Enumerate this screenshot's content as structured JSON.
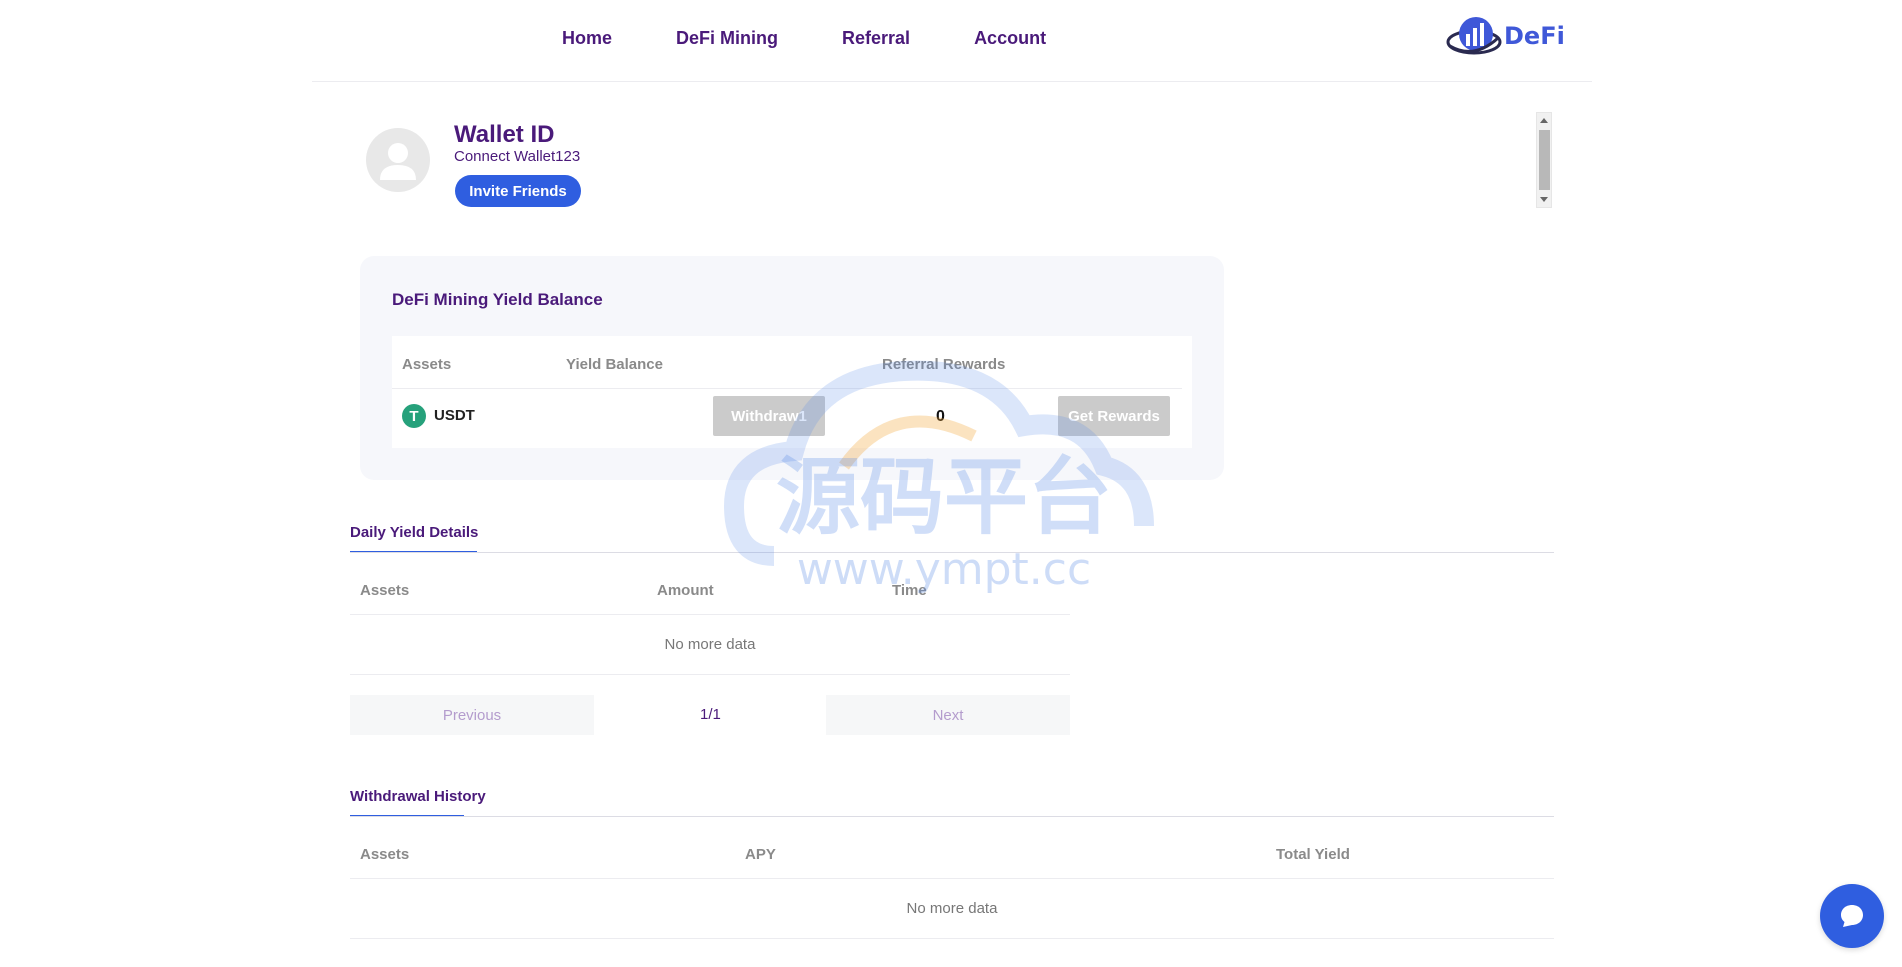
{
  "nav": {
    "items": [
      "Home",
      "DeFi Mining",
      "Referral",
      "Account"
    ],
    "logo_text": "DeFi"
  },
  "profile": {
    "title": "Wallet ID",
    "subtitle": "Connect Wallet123",
    "invite_label": "Invite Friends"
  },
  "yield_card": {
    "title": "DeFi Mining Yield Balance",
    "headers": [
      "Assets",
      "Yield Balance",
      "Referral Rewards"
    ],
    "row": {
      "asset_symbol": "T",
      "asset": "USDT",
      "withdraw_label": "Withdraw1",
      "referral_rewards": "0",
      "get_rewards_label": "Get Rewards"
    }
  },
  "daily_yield": {
    "tab_label": "Daily Yield Details",
    "headers": [
      "Assets",
      "Amount",
      "Time"
    ],
    "empty_text": "No more data",
    "pagination": {
      "previous_label": "Previous",
      "page": "1/1",
      "next_label": "Next"
    }
  },
  "withdrawal_history": {
    "tab_label": "Withdrawal History",
    "headers": [
      "Assets",
      "APY",
      "Total Yield"
    ],
    "empty_text": "No more data"
  },
  "watermark": {
    "text_cn": "源码平台",
    "text_url": "www.ympt.cc"
  },
  "colors": {
    "accent": "#2f5ee0",
    "brand_purple": "#4a1a7a",
    "usdt_green": "#26a17b",
    "disabled_button": "#cbcbcb"
  },
  "icons": {
    "avatar": "user-avatar-icon",
    "chat": "chat-bubble-icon",
    "logo": "defi-logo-icon",
    "usdt": "tether-icon"
  }
}
